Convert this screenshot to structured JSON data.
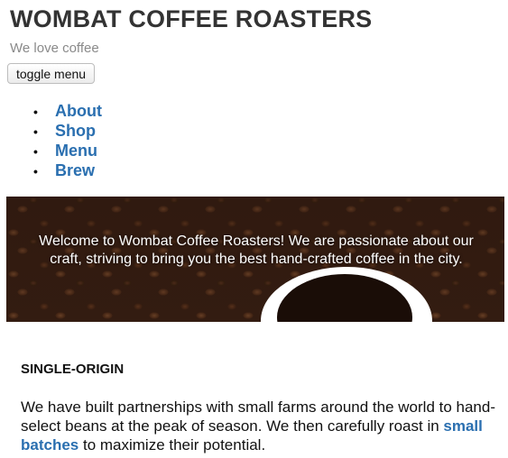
{
  "site": {
    "title": "WOMBAT COFFEE ROASTERS",
    "tagline": "We love coffee"
  },
  "toggle": {
    "label": "toggle menu"
  },
  "nav": {
    "bullet": "•",
    "items": [
      {
        "label": "About"
      },
      {
        "label": "Shop"
      },
      {
        "label": "Menu"
      },
      {
        "label": "Brew"
      }
    ]
  },
  "hero": {
    "text": "Welcome to Wombat Coffee Roasters! We are passionate about our craft, striving to bring you the best hand-crafted coffee in the city."
  },
  "section": {
    "heading": "SINGLE-ORIGIN",
    "text_before": "We have built partnerships with small farms around the world to hand-select beans at the peak of season. We then carefully roast in ",
    "link": "small batches",
    "text_after": " to maximize their potential."
  }
}
